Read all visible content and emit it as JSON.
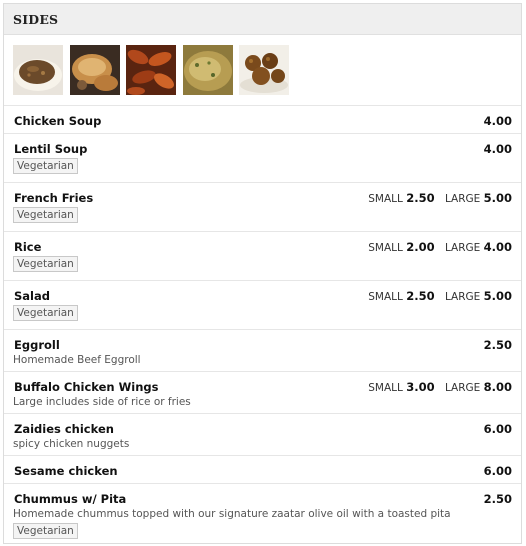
{
  "section": {
    "title": "SIDES"
  },
  "photos": [
    {
      "name": "chicken-soup-photo",
      "alt": "soup"
    },
    {
      "name": "eggroll-photo",
      "alt": "eggroll"
    },
    {
      "name": "wings-photo",
      "alt": "wings"
    },
    {
      "name": "rice-photo",
      "alt": "rice"
    },
    {
      "name": "falafel-photo",
      "alt": "nuggets"
    }
  ],
  "items": [
    {
      "name": "Chicken Soup",
      "price": "4.00"
    },
    {
      "name": "Lentil Soup",
      "price": "4.00",
      "tag": "Vegetarian"
    },
    {
      "name": "French Fries",
      "small_label": "SMALL",
      "small": "2.50",
      "large_label": "LARGE",
      "large": "5.00",
      "tag": "Vegetarian"
    },
    {
      "name": "Rice",
      "small_label": "SMALL",
      "small": "2.00",
      "large_label": "LARGE",
      "large": "4.00",
      "tag": "Vegetarian"
    },
    {
      "name": "Salad",
      "small_label": "SMALL",
      "small": "2.50",
      "large_label": "LARGE",
      "large": "5.00",
      "tag": "Vegetarian"
    },
    {
      "name": "Eggroll",
      "price": "2.50",
      "desc": "Homemade Beef Eggroll"
    },
    {
      "name": "Buffalo Chicken Wings",
      "small_label": "SMALL",
      "small": "3.00",
      "large_label": "LARGE",
      "large": "8.00",
      "desc": "Large includes side of rice or fries"
    },
    {
      "name": "Zaidies chicken",
      "price": "6.00",
      "desc": "spicy chicken nuggets"
    },
    {
      "name": "Sesame chicken",
      "price": "6.00"
    },
    {
      "name": "Chummus w/ Pita",
      "price": "2.50",
      "desc": "Homemade chummus topped with our signature zaatar olive oil with a toasted pita",
      "tag": "Vegetarian"
    }
  ],
  "colors": {
    "header_bg": "#efefef",
    "border": "#e6e6e6",
    "tag_bg": "#f4f4f4"
  }
}
